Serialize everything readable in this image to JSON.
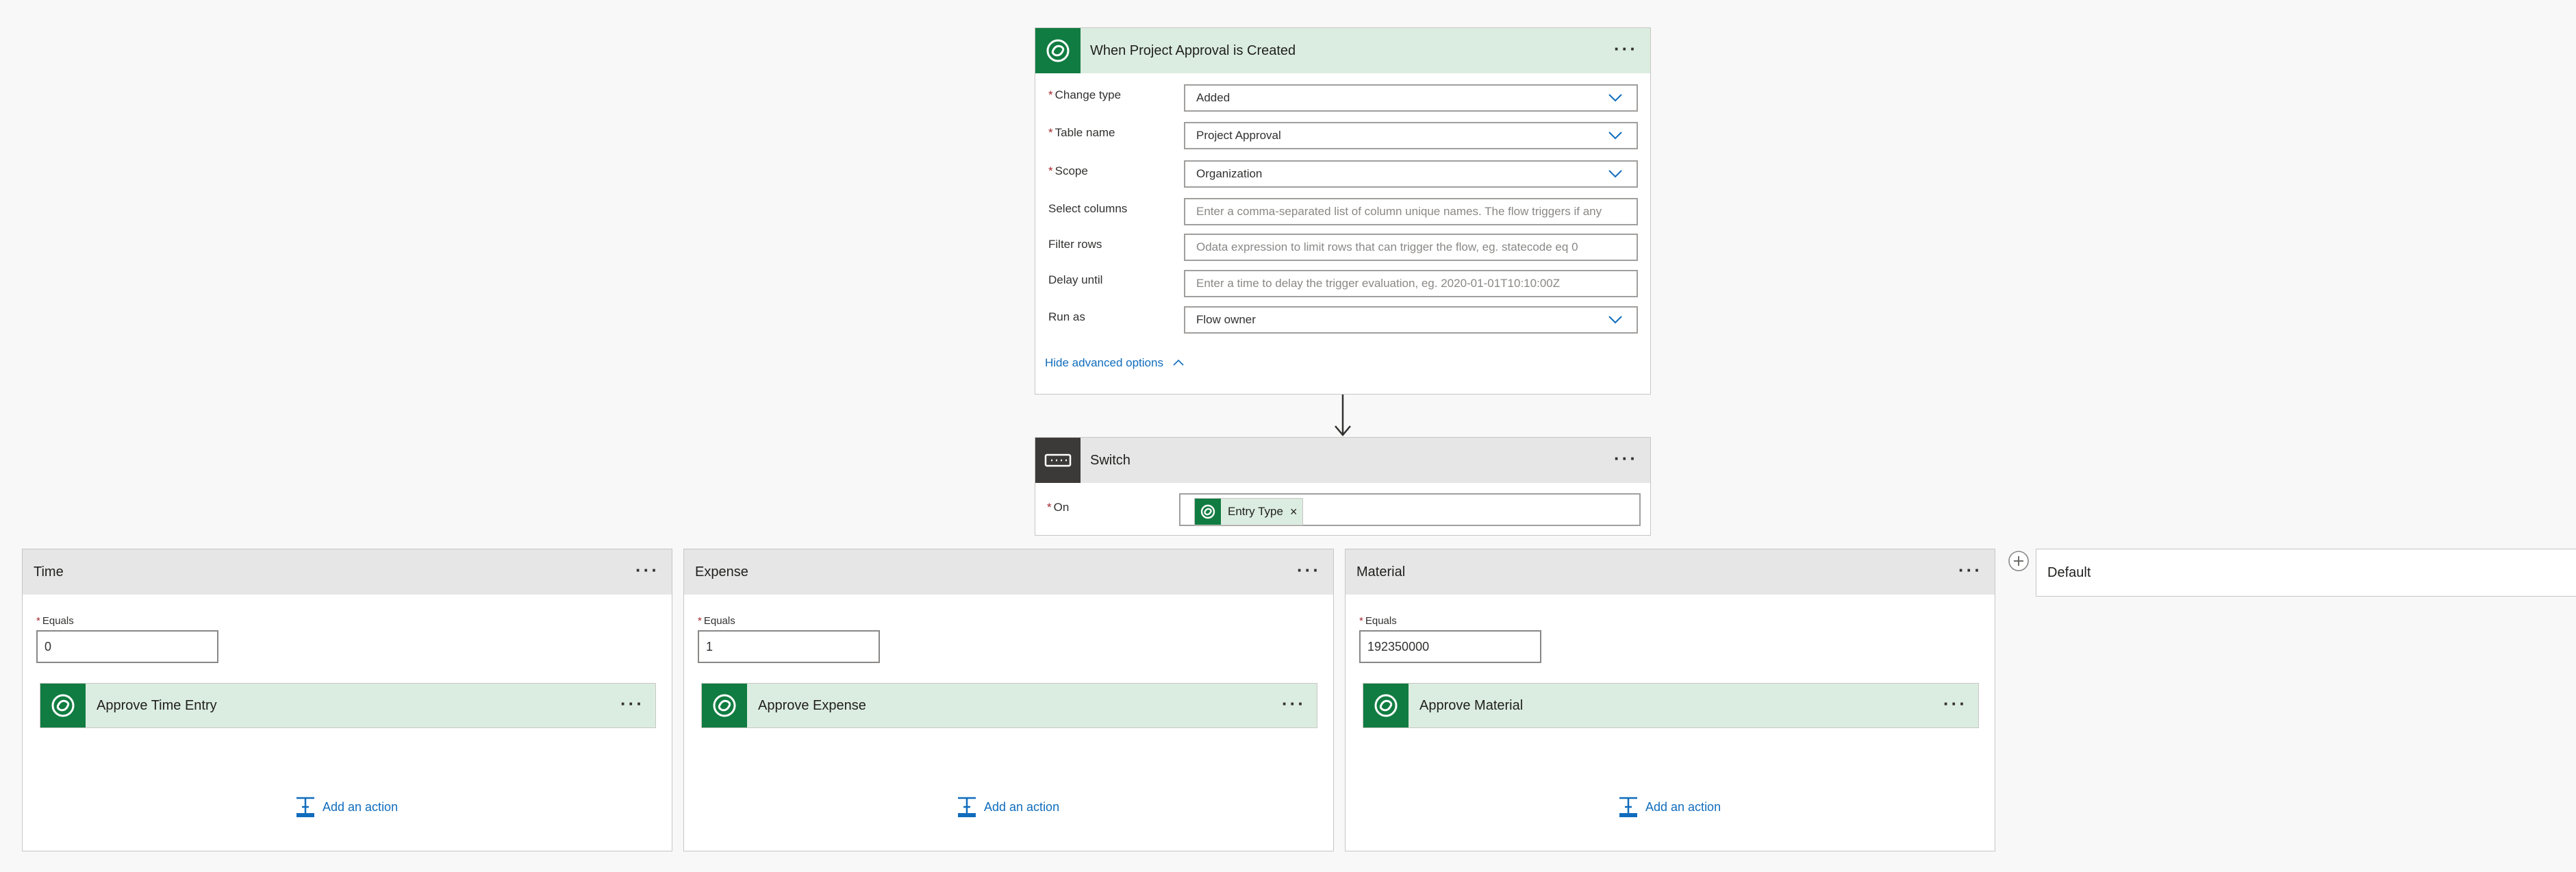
{
  "trigger": {
    "title": "When Project Approval is Created",
    "fields": [
      {
        "label": "Change type",
        "required": "*",
        "value": "Added"
      },
      {
        "label": "Table name",
        "required": "*",
        "value": "Project Approval"
      },
      {
        "label": "Scope",
        "required": "*",
        "value": "Organization"
      },
      {
        "label": "Select columns",
        "placeholder": "Enter a comma-separated list of column unique names. The flow triggers if any"
      },
      {
        "label": "Filter rows",
        "placeholder": "Odata expression to limit rows that can trigger the flow, eg. statecode eq 0"
      },
      {
        "label": "Delay until",
        "placeholder": "Enter a time to delay the trigger evaluation, eg. 2020-01-01T10:10:00Z"
      },
      {
        "label": "Run as",
        "value": "Flow owner"
      }
    ],
    "hide_advanced": "Hide advanced options"
  },
  "switch": {
    "title": "Switch",
    "on_label": "On",
    "required": "*",
    "token": "Entry Type",
    "token_remove": "×"
  },
  "cases": [
    {
      "title": "Time",
      "equals_label": "Equals",
      "required": "*",
      "value": "0",
      "action": "Approve Time Entry",
      "add_action": "Add an action"
    },
    {
      "title": "Expense",
      "equals_label": "Equals",
      "required": "*",
      "value": "1",
      "action": "Approve Expense",
      "add_action": "Add an action"
    },
    {
      "title": "Material",
      "equals_label": "Equals",
      "required": "*",
      "value": "192350000",
      "action": "Approve Material",
      "add_action": "Add an action"
    }
  ],
  "default_case": {
    "title": "Default"
  },
  "menu_dots": "···",
  "colors": {
    "accent_green": "#107c41",
    "header_green": "#dbede0",
    "link_blue": "#0f6cbd",
    "switch_dark": "#3b3a39"
  },
  "icons": [
    "dataverse-icon",
    "switch-icon",
    "chevron-down-icon",
    "chevron-up-icon",
    "arrow-down-icon",
    "add-action-icon",
    "plus-circle-icon",
    "remove-icon",
    "more-options-icon"
  ]
}
